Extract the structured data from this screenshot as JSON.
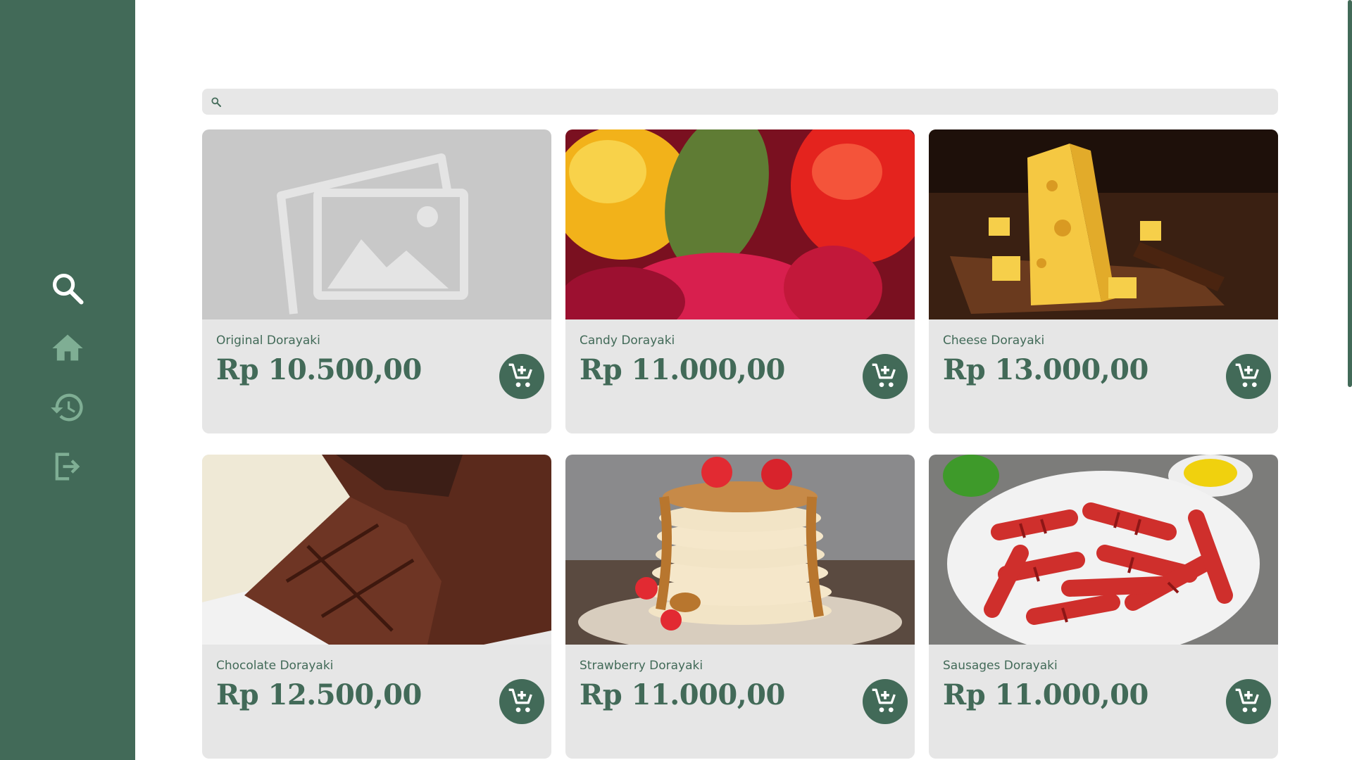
{
  "sidebar": {
    "items": [
      {
        "name": "search",
        "icon": "search-icon"
      },
      {
        "name": "home",
        "icon": "home-icon"
      },
      {
        "name": "history",
        "icon": "history-icon"
      },
      {
        "name": "logout",
        "icon": "logout-icon"
      }
    ],
    "active": "search"
  },
  "search": {
    "value": "",
    "placeholder": "",
    "icon": "search-icon"
  },
  "products": [
    {
      "name": "Original Dorayaki",
      "price": "Rp 10.500,00",
      "image": "placeholder-image-icon"
    },
    {
      "name": "Candy Dorayaki",
      "price": "Rp 11.000,00",
      "image": "candy-photo"
    },
    {
      "name": "Cheese Dorayaki",
      "price": "Rp 13.000,00",
      "image": "cheese-photo"
    },
    {
      "name": "Chocolate Dorayaki",
      "price": "Rp 12.500,00",
      "image": "chocolate-photo"
    },
    {
      "name": "Strawberry Dorayaki",
      "price": "Rp 11.000,00",
      "image": "pancake-photo"
    },
    {
      "name": "Sausages Dorayaki",
      "price": "Rp 11.000,00",
      "image": "sausages-photo"
    }
  ],
  "colors": {
    "primary": "#426a58",
    "sidebar_icon": "#7fae94",
    "card_bg": "#e6e6e6",
    "search_bg": "#e7e7e7"
  }
}
